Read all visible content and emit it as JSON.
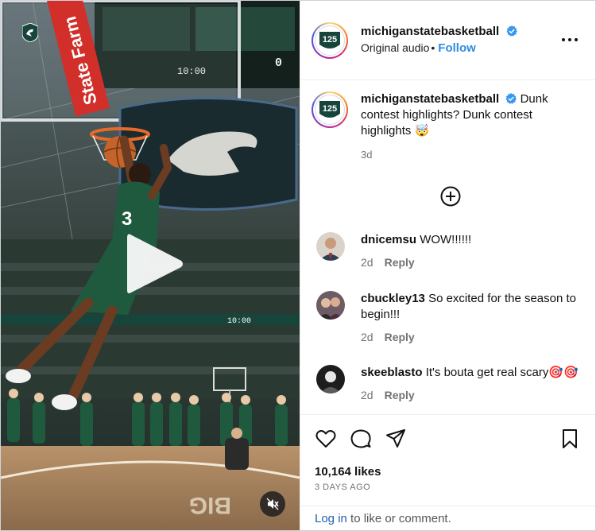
{
  "post": {
    "username": "michiganstatebasketball",
    "audio": "Original audio",
    "follow_label": "Follow",
    "avatar_text": "125"
  },
  "video": {
    "sponsor_text": "State Farm",
    "jersey_number": "3",
    "scoreboard_clock": "10:00",
    "scoreboard_score": "0",
    "court_text": "BIG"
  },
  "caption": {
    "username": "michiganstatebasketball",
    "text": "Dunk contest highlights? Dunk contest highlights 🤯",
    "time": "3d"
  },
  "comments": [
    {
      "username": "dnicemsu",
      "text": "WOW!!!!!!",
      "time": "2d",
      "reply": "Reply"
    },
    {
      "username": "cbuckley13",
      "text": "So excited for the season to begin!!!",
      "time": "2d",
      "reply": "Reply"
    },
    {
      "username": "skeeblasto",
      "text": "It's bouta get real scary🎯🎯",
      "time": "2d",
      "reply": "Reply"
    }
  ],
  "engagement": {
    "likes": "10,164 likes",
    "date": "3 DAYS AGO",
    "login_link": "Log in",
    "login_suffix": " to like or comment."
  },
  "icons": [
    "play-icon",
    "mute-icon",
    "verified-icon",
    "more-icon",
    "add-comment-icon",
    "heart-icon",
    "comment-icon",
    "share-icon",
    "bookmark-icon"
  ],
  "colors": {
    "follow": "#2f8ce0",
    "verified": "#3897f0",
    "muted_text": "#737373",
    "msu_green": "#18453b"
  }
}
